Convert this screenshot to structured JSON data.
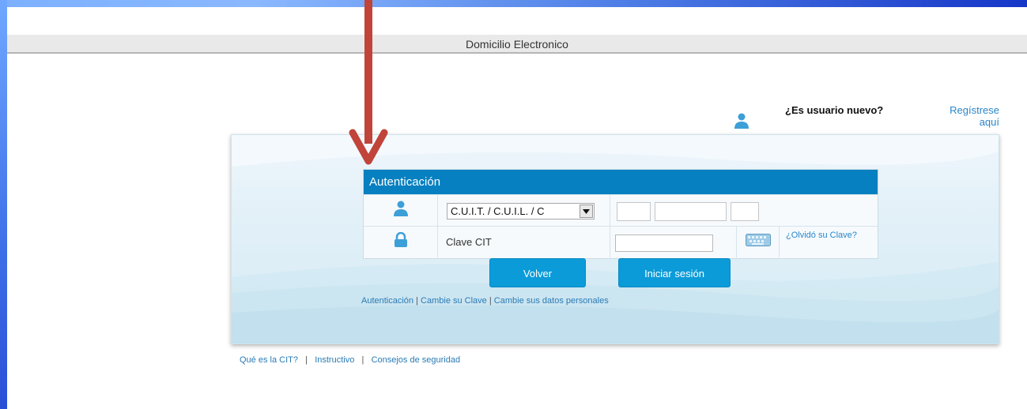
{
  "header": {
    "title": "Domicilio Electronico"
  },
  "new_user": {
    "question": "¿Es usuario nuevo?",
    "register_link": "Regístrese aquí"
  },
  "auth": {
    "heading": "Autenticación",
    "id_type_selected": "C.U.I.T. / C.U.I.L. / C",
    "password_label": "Clave CIT",
    "forgot_link": "¿Olvidó su Clave?"
  },
  "buttons": {
    "back": "Volver",
    "login": "Iniciar sesión"
  },
  "panel_links": [
    "Autenticación",
    "Cambie su Clave",
    "Cambie sus datos personales"
  ],
  "footer_links": [
    "Qué es la CIT?",
    "Instructivo",
    "Consejos de seguridad"
  ],
  "colors": {
    "accent": "#0680c0",
    "button": "#0b9bd8",
    "link": "#2a86c8",
    "annotation_arrow": "#c0443a"
  },
  "icons": {
    "user": "user-icon",
    "lock": "lock-icon",
    "keyboard": "keyboard-icon",
    "dropdown": "chevron-down-icon"
  }
}
